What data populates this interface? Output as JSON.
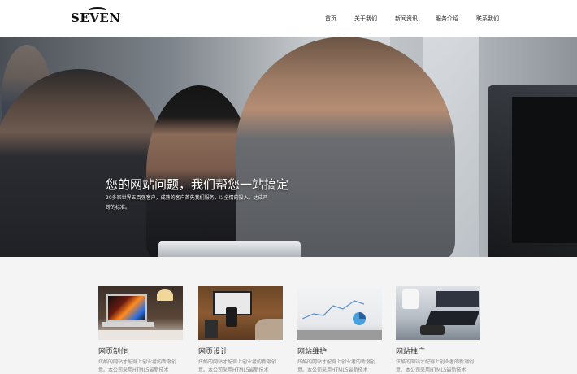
{
  "header": {
    "logo": "SEVEN",
    "nav": [
      "首页",
      "关于我们",
      "新闻资讯",
      "服务介绍",
      "联系我们"
    ]
  },
  "hero": {
    "title": "您的网站问题，我们帮您一站搞定",
    "subtitle": "20多家世界五百强客户，成熟的客户首先我们服务，以全情的投入，达成严苛的标准。"
  },
  "services": [
    {
      "title": "网页制作",
      "desc": "炫酷的网站才配得上创业者的新潮创意。本公司采用HTML5最新技术"
    },
    {
      "title": "网页设计",
      "desc": "炫酷的网站才配得上创业者的新潮创意。本公司采用HTML5最新技术"
    },
    {
      "title": "网站维护",
      "desc": "炫酷的网站才配得上创业者的新潮创意。本公司采用HTML5最新技术"
    },
    {
      "title": "网站推广",
      "desc": "炫酷的网站才配得上创业者的新潮创意。本公司采用HTML5最新技术"
    }
  ]
}
